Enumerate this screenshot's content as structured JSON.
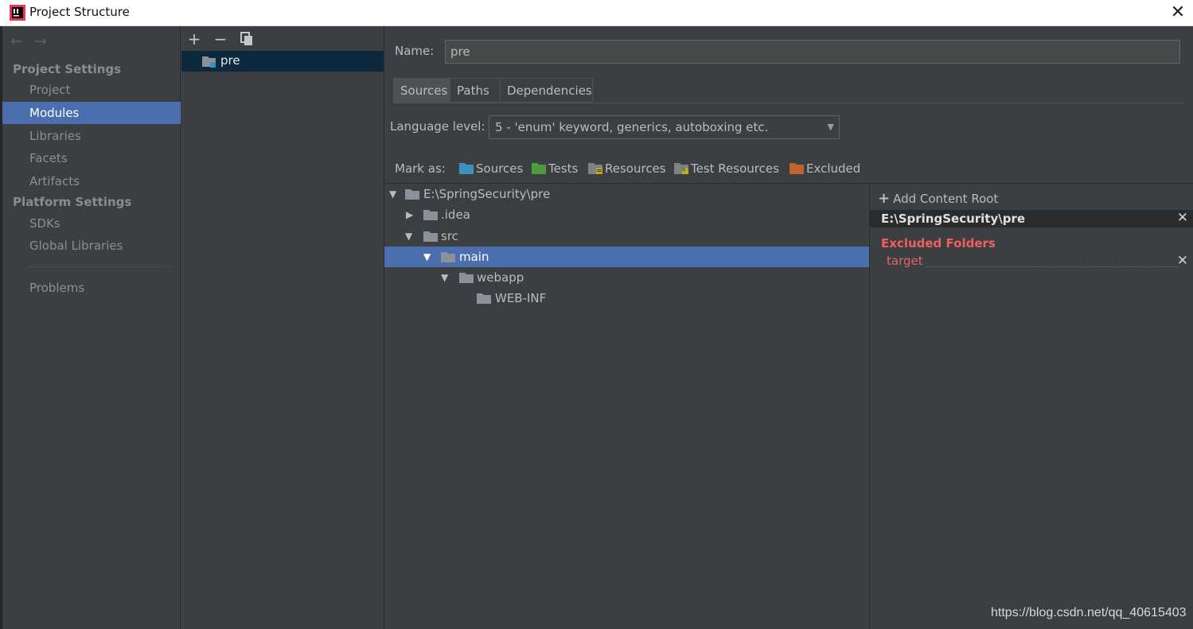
{
  "window": {
    "title": "Project Structure",
    "close_glyph": "✕"
  },
  "nav": {
    "back_glyph": "←",
    "forward_glyph": "→",
    "project_settings_heading": "Project Settings",
    "platform_settings_heading": "Platform Settings",
    "items": {
      "project": "Project",
      "modules": "Modules",
      "libraries": "Libraries",
      "facets": "Facets",
      "artifacts": "Artifacts",
      "sdks": "SDKs",
      "global_libraries": "Global Libraries",
      "problems": "Problems"
    },
    "selected": "Modules"
  },
  "modules": {
    "toolbar": {
      "add": "+",
      "remove": "−",
      "copy": "copy-icon"
    },
    "list": [
      {
        "name": "pre"
      }
    ]
  },
  "editor": {
    "name_label": "Name:",
    "name_value": "pre",
    "tabs": [
      "Sources",
      "Paths",
      "Dependencies"
    ],
    "active_tab": "Sources",
    "language_level_label": "Language level:",
    "language_level_value": "5 - 'enum' keyword, generics, autoboxing etc.",
    "mark_as_label": "Mark as:",
    "mark_as": [
      {
        "label": "Sources",
        "color": "#3d8fbd"
      },
      {
        "label": "Tests",
        "color": "#4f9a3c"
      },
      {
        "label": "Resources",
        "color": "#7d8285"
      },
      {
        "label": "Test Resources",
        "color": "#7d8285"
      },
      {
        "label": "Excluded",
        "color": "#c0642e"
      }
    ]
  },
  "tree": [
    {
      "label": "E:\\SpringSecurity\\pre",
      "expanded": true
    },
    {
      "label": ".idea",
      "expanded": false
    },
    {
      "label": "src",
      "expanded": true
    },
    {
      "label": "main",
      "expanded": true,
      "selected": true
    },
    {
      "label": "webapp",
      "expanded": true
    },
    {
      "label": "WEB-INF"
    }
  ],
  "content_roots": {
    "add_label": "Add Content Root",
    "root_path": "E:\\SpringSecurity\\pre",
    "excluded_heading": "Excluded Folders",
    "excluded": [
      "target"
    ]
  },
  "watermark": "https://blog.csdn.net/qq_40615403",
  "colors": {
    "background": "#3c3f41",
    "selection": "#4b6eaf",
    "excluded_text": "#f25d5d",
    "module_selection": "#0d293e"
  }
}
